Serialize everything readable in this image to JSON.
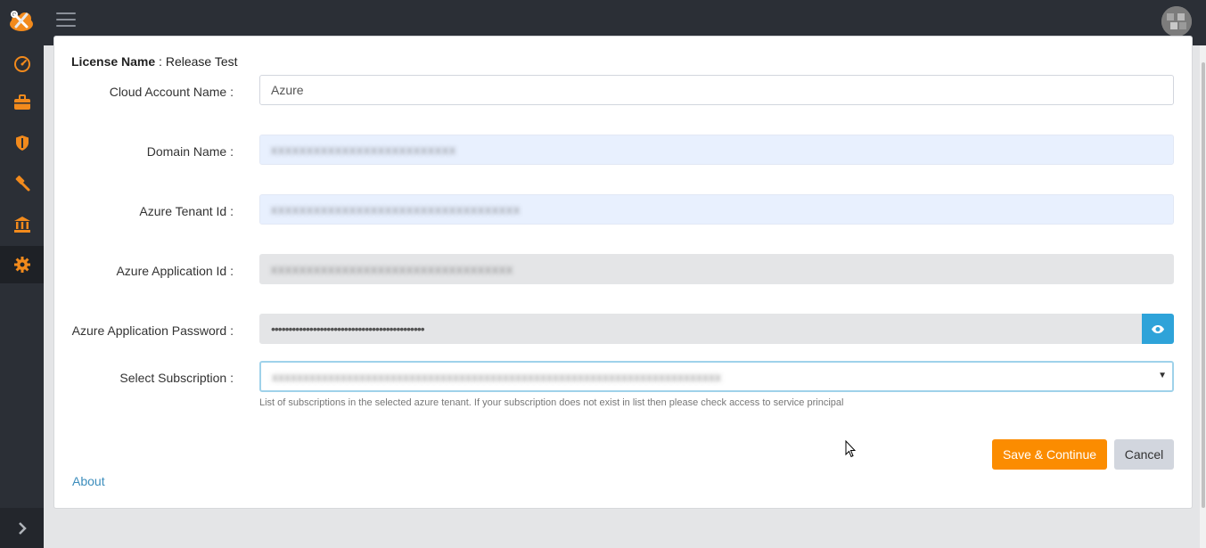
{
  "topbar": {
    "logo_icon": "wrench-cloud-logo",
    "menu_icon": "hamburger-icon",
    "avatar_icon": "user-avatar"
  },
  "sidebar": {
    "items": [
      {
        "icon": "dashboard-gauge-icon"
      },
      {
        "icon": "briefcase-icon"
      },
      {
        "icon": "shield-icon"
      },
      {
        "icon": "hammer-icon"
      },
      {
        "icon": "bank-icon"
      },
      {
        "icon": "gear-icon",
        "active": true
      }
    ],
    "expand_icon": "chevron-right-icon",
    "accent_color": "#f28a1c"
  },
  "license": {
    "label": "License Name",
    "separator": " : ",
    "value": "Release Test"
  },
  "form": {
    "cloud_account_name": {
      "label": "Cloud Account Name :",
      "value": "Azure"
    },
    "domain_name": {
      "label": "Domain Name :",
      "value": "xxxxxxxxxxxxxxxxxxxxxxxxxx"
    },
    "azure_tenant_id": {
      "label": "Azure Tenant Id :",
      "value": "xxxxxxxxxxxxxxxxxxxxxxxxxxxxxxxxxxx"
    },
    "azure_application_id": {
      "label": "Azure Application Id :",
      "value": "xxxxxxxxxxxxxxxxxxxxxxxxxxxxxxxxxx"
    },
    "azure_application_password": {
      "label": "Azure Application Password :",
      "value": "••••••••••••••••••••••••••••••••••••••••••••",
      "toggle_icon": "eye-icon"
    },
    "select_subscription": {
      "label": "Select Subscription :",
      "value": "xxxxxxxxxxxxxxxxxxxxxxxxxxxxxxxxxxxxxxxxxxxxxxxxxxxxxxxxxxxxxxxxxxxxxxxx",
      "help": "List of subscriptions in the selected azure tenant. If your subscription does not exist in list then please check access to service principal"
    }
  },
  "actions": {
    "save_label": "Save & Continue",
    "cancel_label": "Cancel",
    "save_color": "#fb8c00"
  },
  "footer": {
    "about_label": "About"
  }
}
